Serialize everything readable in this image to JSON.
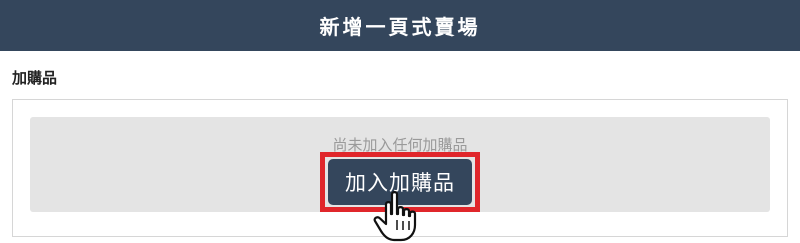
{
  "header": {
    "title": "新增一頁式賣場"
  },
  "addon_section": {
    "label": "加購品",
    "empty_message": "尚未加入任何加購品",
    "add_button_label": "加入加購品"
  },
  "colors": {
    "header_bg": "#34465c",
    "button_bg": "#34465c",
    "highlight_border": "#e0262b",
    "panel_bg": "#e4e4e4"
  },
  "icons": {
    "cursor": "hand-pointer-icon"
  }
}
